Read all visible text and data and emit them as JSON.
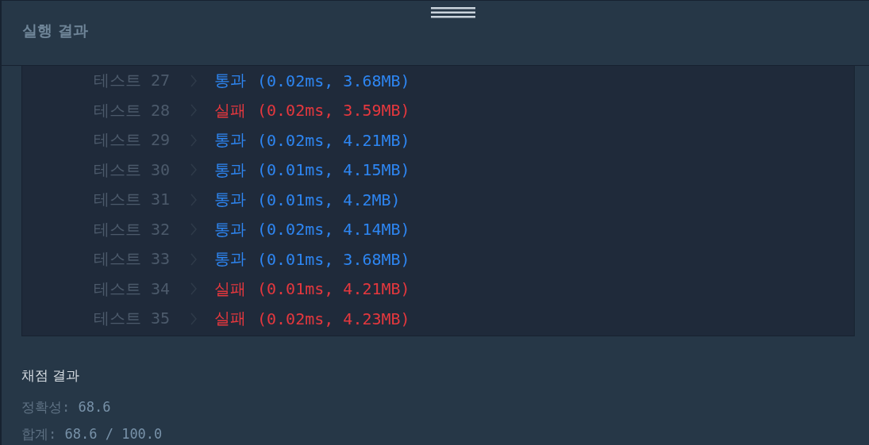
{
  "header": {
    "title": "실행 결과"
  },
  "tests": [
    {
      "label": "테스트 27",
      "color": "#2e86f2",
      "result": "통과",
      "detail": "(0.02ms, 3.68MB)"
    },
    {
      "label": "테스트 28",
      "color": "#e5383e",
      "result": "실패",
      "detail": "(0.02ms, 3.59MB)"
    },
    {
      "label": "테스트 29",
      "color": "#2e86f2",
      "result": "통과",
      "detail": "(0.02ms, 4.21MB)"
    },
    {
      "label": "테스트 30",
      "color": "#2e86f2",
      "result": "통과",
      "detail": "(0.01ms, 4.15MB)"
    },
    {
      "label": "테스트 31",
      "color": "#2e86f2",
      "result": "통과",
      "detail": "(0.01ms, 4.2MB)"
    },
    {
      "label": "테스트 32",
      "color": "#2e86f2",
      "result": "통과",
      "detail": "(0.02ms, 4.14MB)"
    },
    {
      "label": "테스트 33",
      "color": "#2e86f2",
      "result": "통과",
      "detail": "(0.01ms, 3.68MB)"
    },
    {
      "label": "테스트 34",
      "color": "#e5383e",
      "result": "실패",
      "detail": "(0.01ms, 4.21MB)"
    },
    {
      "label": "테스트 35",
      "color": "#e5383e",
      "result": "실패",
      "detail": "(0.02ms, 4.23MB)"
    }
  ],
  "grading": {
    "title": "채점 결과",
    "lines": [
      {
        "label": "정확성:",
        "value": "68.6"
      },
      {
        "label": "합계:",
        "value": "68.6 / 100.0"
      }
    ]
  }
}
